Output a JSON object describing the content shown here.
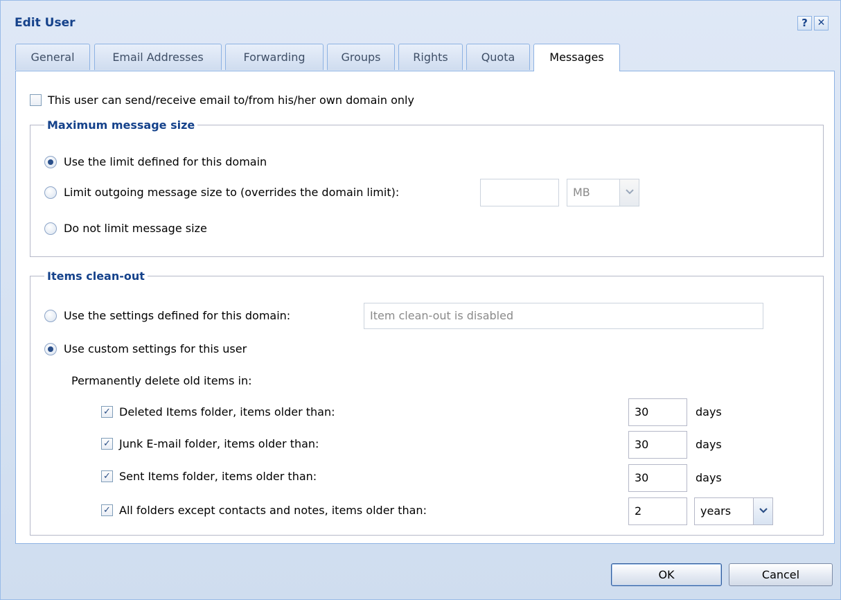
{
  "window": {
    "title": "Edit User",
    "help_icon": "?",
    "close_icon": "✕"
  },
  "tabs": [
    {
      "label": "General",
      "active": false
    },
    {
      "label": "Email Addresses",
      "active": false
    },
    {
      "label": "Forwarding",
      "active": false
    },
    {
      "label": "Groups",
      "active": false
    },
    {
      "label": "Rights",
      "active": false
    },
    {
      "label": "Quota",
      "active": false
    },
    {
      "label": "Messages",
      "active": true
    }
  ],
  "own_domain_only": {
    "label": "This user can send/receive email to/from his/her own domain only",
    "checked": false
  },
  "max_size": {
    "legend": "Maximum message size",
    "options": [
      {
        "label": "Use the limit defined for this domain",
        "selected": true
      },
      {
        "label": "Limit outgoing message size to (overrides the domain limit):",
        "selected": false
      },
      {
        "label": "Do not limit message size",
        "selected": false
      }
    ],
    "size_value": "",
    "unit": "MB"
  },
  "cleanout": {
    "legend": "Items clean-out",
    "use_domain": {
      "label": "Use the settings defined for this domain:",
      "selected": false
    },
    "domain_setting_text": "Item clean-out is disabled",
    "use_custom": {
      "label": "Use custom settings for this user",
      "selected": true
    },
    "permanently_label": "Permanently delete old items in:",
    "rules": [
      {
        "label": "Deleted Items folder, items older than:",
        "checked": true,
        "value": "30",
        "unit": "days"
      },
      {
        "label": "Junk E-mail folder, items older than:",
        "checked": true,
        "value": "30",
        "unit": "days"
      },
      {
        "label": "Sent Items folder, items older than:",
        "checked": true,
        "value": "30",
        "unit": "days"
      },
      {
        "label": "All folders except contacts and notes, items older than:",
        "checked": true,
        "value": "2",
        "unit": "years"
      }
    ]
  },
  "buttons": {
    "ok": "OK",
    "cancel": "Cancel"
  },
  "colors": {
    "title": "#15428b",
    "border": "#99bbe8",
    "panel_bg": "#ffffff",
    "window_bg": "#dfe8f6"
  },
  "icons": {
    "checkmark": "✓"
  }
}
